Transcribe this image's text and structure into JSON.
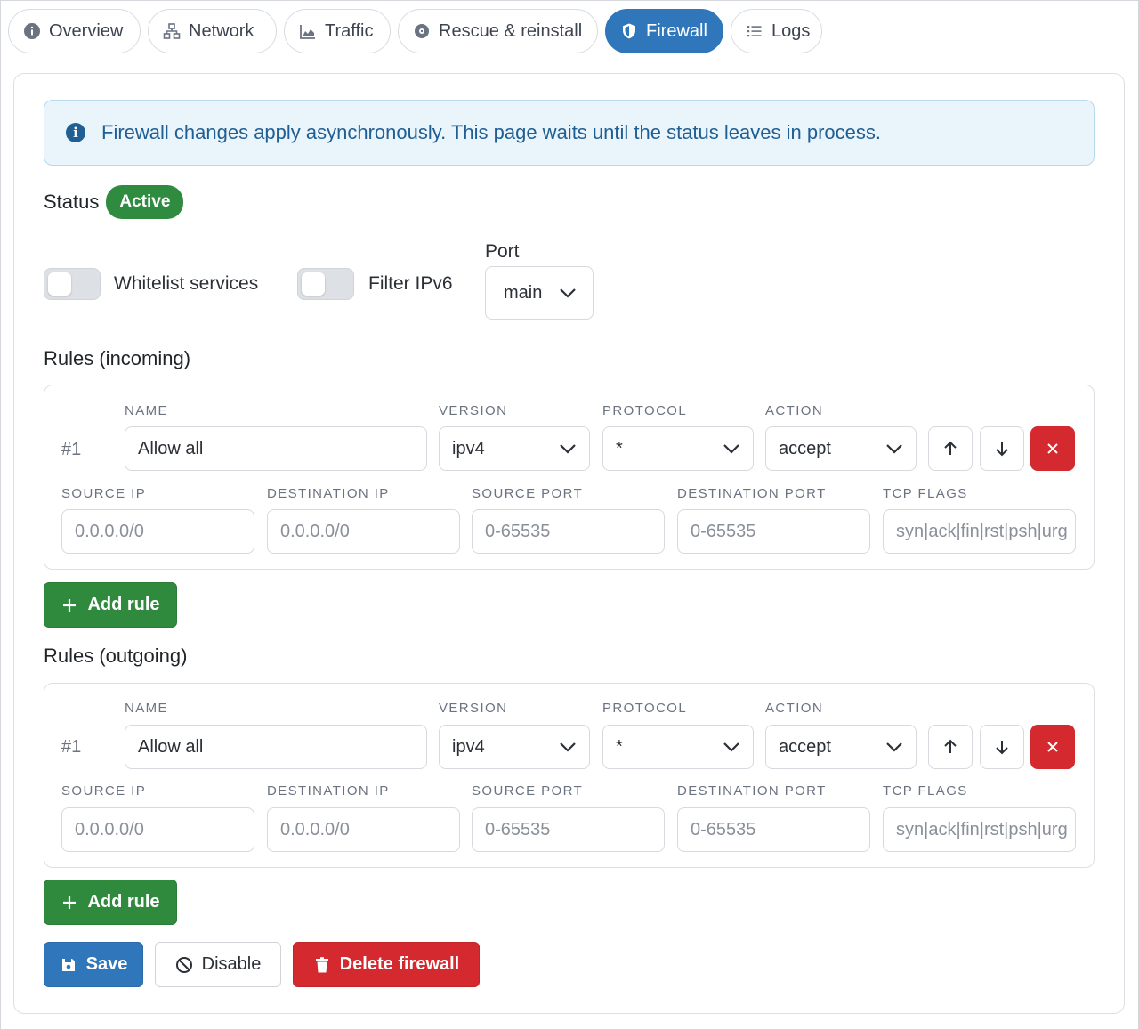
{
  "tabs": [
    {
      "label": "Overview",
      "icon": "info-circle-icon"
    },
    {
      "label": "Network",
      "icon": "network-icon"
    },
    {
      "label": "Traffic",
      "icon": "area-chart-icon"
    },
    {
      "label": "Rescue & reinstall",
      "icon": "disc-icon"
    },
    {
      "label": "Firewall",
      "icon": "shield-icon",
      "active": true
    },
    {
      "label": "Logs",
      "icon": "list-icon"
    }
  ],
  "alert": {
    "text": "Firewall changes apply asynchronously. This page waits until the status leaves in process."
  },
  "status": {
    "label": "Status",
    "value": "Active"
  },
  "toggles": {
    "whitelist": {
      "label": "Whitelist services",
      "on": false
    },
    "ipv6": {
      "label": "Filter IPv6",
      "on": false
    }
  },
  "port": {
    "label": "Port",
    "value": "main"
  },
  "columns": {
    "name": "NAME",
    "version": "VERSION",
    "protocol": "PROTOCOL",
    "action": "ACTION",
    "source_ip": "SOURCE IP",
    "destination_ip": "DESTINATION IP",
    "source_port": "SOURCE PORT",
    "destination_port": "DESTINATION PORT",
    "tcp_flags": "TCP FLAGS"
  },
  "incoming": {
    "title": "Rules (incoming)",
    "rule": {
      "number": "#1",
      "name": "Allow all",
      "version": "ipv4",
      "protocol": "*",
      "action": "accept",
      "source_ip_placeholder": "0.0.0.0/0",
      "destination_ip_placeholder": "0.0.0.0/0",
      "source_port_placeholder": "0-65535",
      "destination_port_placeholder": "0-65535",
      "tcp_flags_placeholder": "syn|ack|fin|rst|psh|urg"
    },
    "add_label": "Add rule"
  },
  "outgoing": {
    "title": "Rules (outgoing)",
    "rule": {
      "number": "#1",
      "name": "Allow all",
      "version": "ipv4",
      "protocol": "*",
      "action": "accept",
      "source_ip_placeholder": "0.0.0.0/0",
      "destination_ip_placeholder": "0.0.0.0/0",
      "source_port_placeholder": "0-65535",
      "destination_port_placeholder": "0-65535",
      "tcp_flags_placeholder": "syn|ack|fin|rst|psh|urg"
    },
    "add_label": "Add rule"
  },
  "actions": {
    "save": "Save",
    "disable": "Disable",
    "delete": "Delete firewall"
  },
  "colors": {
    "primary": "#2f76ba",
    "success": "#2f8a3d",
    "danger": "#d3292f",
    "info_bg": "#eaf4fb"
  }
}
